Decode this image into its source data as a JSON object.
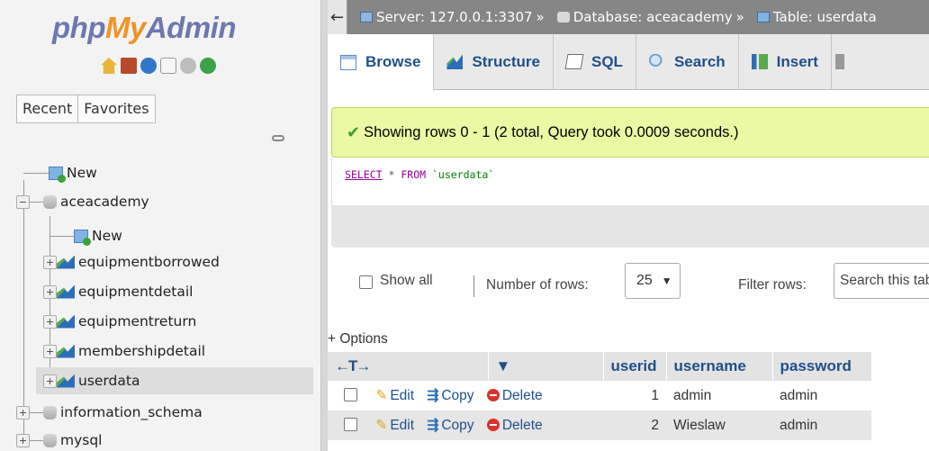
{
  "nav": {
    "logo": {
      "php": "php",
      "my": "My",
      "admin": "Admin"
    },
    "icons": [
      "home-icon",
      "logout-icon",
      "docs-icon",
      "sql-docs-icon",
      "settings-icon",
      "reload-icon"
    ],
    "tabs": {
      "recent": "Recent",
      "favorites": "Favorites"
    },
    "tree": {
      "new_top": "New",
      "db_aceacademy": "aceacademy",
      "new_table": "New",
      "tables": [
        "equipmentborrowed",
        "equipmentdetail",
        "equipmentreturn",
        "membershipdetail",
        "userdata"
      ],
      "db_information_schema": "information_schema",
      "db_mysql": "mysql"
    }
  },
  "breadcrumb": {
    "collapse": "←",
    "server": "Server: 127.0.0.1:3307",
    "sep": "»",
    "database": "Database: aceacademy",
    "table": "Table: userdata"
  },
  "tabs": [
    {
      "label": "Browse",
      "icon": "browse-icon"
    },
    {
      "label": "Structure",
      "icon": "structure-icon"
    },
    {
      "label": "SQL",
      "icon": "sql-icon"
    },
    {
      "label": "Search",
      "icon": "search-icon"
    },
    {
      "label": "Insert",
      "icon": "insert-icon"
    }
  ],
  "message": {
    "text": "Showing rows 0 - 1 (2 total, Query took 0.0009 seconds.)",
    "color": "#ebf8a4"
  },
  "query": {
    "select": "SELECT",
    "star": "*",
    "from": "FROM",
    "table": "`userdata`"
  },
  "controls": {
    "show_all": "Show all",
    "number_of_rows": "Number of rows:",
    "rows_value": "25",
    "filter_rows": "Filter rows:",
    "filter_placeholder": "Search this table"
  },
  "options": "+ Options",
  "results": {
    "columns": [
      "userid",
      "username",
      "password"
    ],
    "actions": {
      "edit": "Edit",
      "copy": "Copy",
      "delete": "Delete"
    },
    "rows": [
      {
        "userid": "1",
        "username": "admin",
        "password": "admin"
      },
      {
        "userid": "2",
        "username": "Wieslaw",
        "password": "admin"
      }
    ]
  }
}
